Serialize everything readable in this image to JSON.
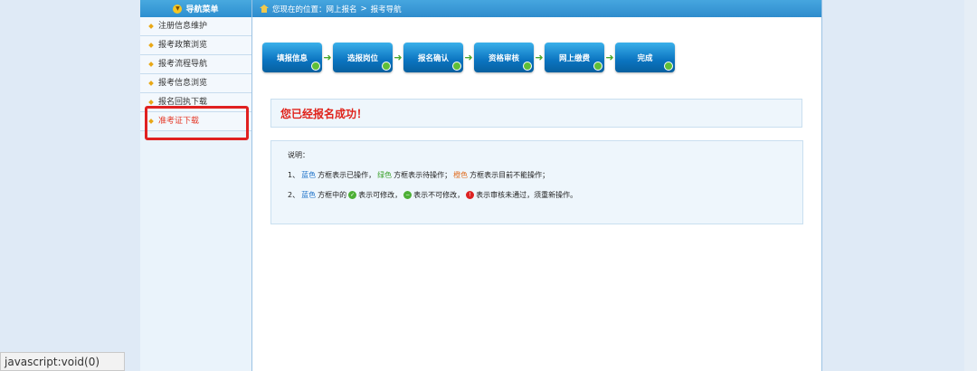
{
  "nav": {
    "header": "导航菜单",
    "items": [
      {
        "label": "注册信息维护"
      },
      {
        "label": "报考政策浏览"
      },
      {
        "label": "报考流程导航"
      },
      {
        "label": "报考信息浏览"
      },
      {
        "label": "报名回执下载"
      },
      {
        "label": "准考证下载"
      }
    ]
  },
  "breadcrumb": {
    "prefix": "您现在的位置：网上报名",
    "sep": ">",
    "current": "报考导航"
  },
  "steps": [
    {
      "label": "填报信息"
    },
    {
      "label": "选报岗位"
    },
    {
      "label": "报名确认"
    },
    {
      "label": "资格审核"
    },
    {
      "label": "网上缴费"
    },
    {
      "label": "完成"
    }
  ],
  "success_message": "您已经报名成功！",
  "notes": {
    "title": "说明：",
    "line1": {
      "num": "1、",
      "blue": "蓝色",
      "t1": "方框表示已操作，",
      "green": "绿色",
      "t2": "方框表示待操作；",
      "orange": "橙色",
      "t3": "方框表示目前不能操作；"
    },
    "line2": {
      "num": "2、",
      "blue": "蓝色",
      "t1": "方框中的",
      "t2": "表示可修改，",
      "t3": "表示不可修改，",
      "t4": "表示审核未通过，须重新操作。"
    }
  },
  "statusbar": "javascript:void(0)",
  "colors": {
    "accent": "#2d8fd0",
    "highlight": "#e02020",
    "success_text": "#e0231b"
  }
}
